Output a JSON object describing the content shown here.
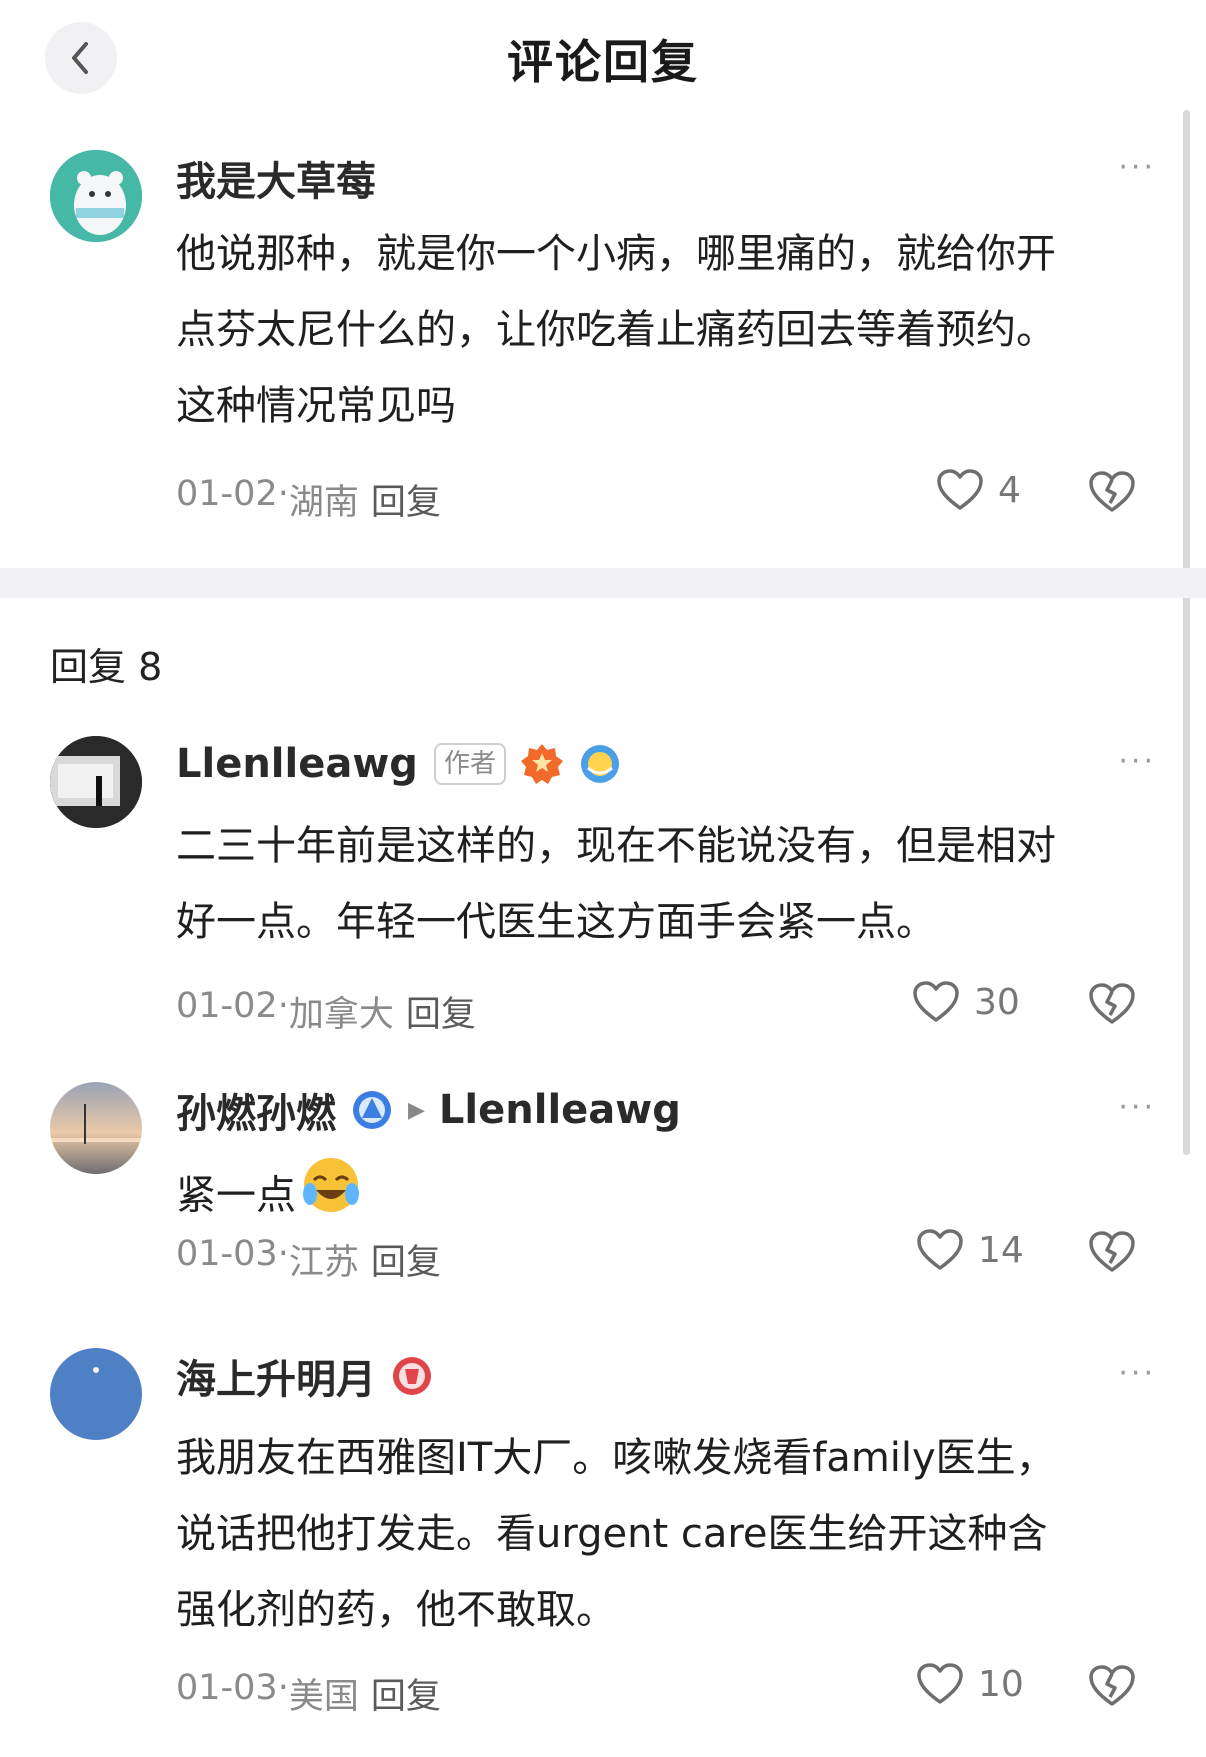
{
  "header": {
    "title": "评论回复"
  },
  "main_comment": {
    "user": "我是大草莓",
    "text_lines": [
      "他说那种，就是你一个小病，哪里痛的，就给你开",
      "点芬太尼什么的，让你吃着止痛药回去等着预约。",
      "这种情况常见吗"
    ],
    "date": "01-02",
    "location": "湖南",
    "reply_label": "回复",
    "likes": "4"
  },
  "replies_header": "回复 8",
  "replies": [
    {
      "user": "Llenlleawg",
      "author_tag": "作者",
      "text_lines": [
        "二三十年前是这样的，现在不能说没有，但是相对",
        "好一点。年轻一代医生这方面手会紧一点。"
      ],
      "date": "01-02",
      "location": "加拿大",
      "reply_label": "回复",
      "likes": "30"
    },
    {
      "user": "孙燃孙燃",
      "reply_to": "Llenlleawg",
      "text": "紧一点",
      "date": "01-03",
      "location": "江苏",
      "reply_label": "回复",
      "likes": "14"
    },
    {
      "user": "海上升明月",
      "text_lines": [
        "我朋友在西雅图IT大厂。咳嗽发烧看family医生，",
        "说话把他打发走。看urgent care医生给开这种含",
        "强化剂的药，他不敢取。"
      ],
      "date": "01-03",
      "location": "美国",
      "reply_label": "回复",
      "likes": "10"
    }
  ],
  "separator": " · ",
  "more_glyph": "···",
  "colors": {
    "accent_orange": "#f26a2b",
    "badge_blue": "#3b7de0",
    "badge_red": "#e0454b"
  }
}
